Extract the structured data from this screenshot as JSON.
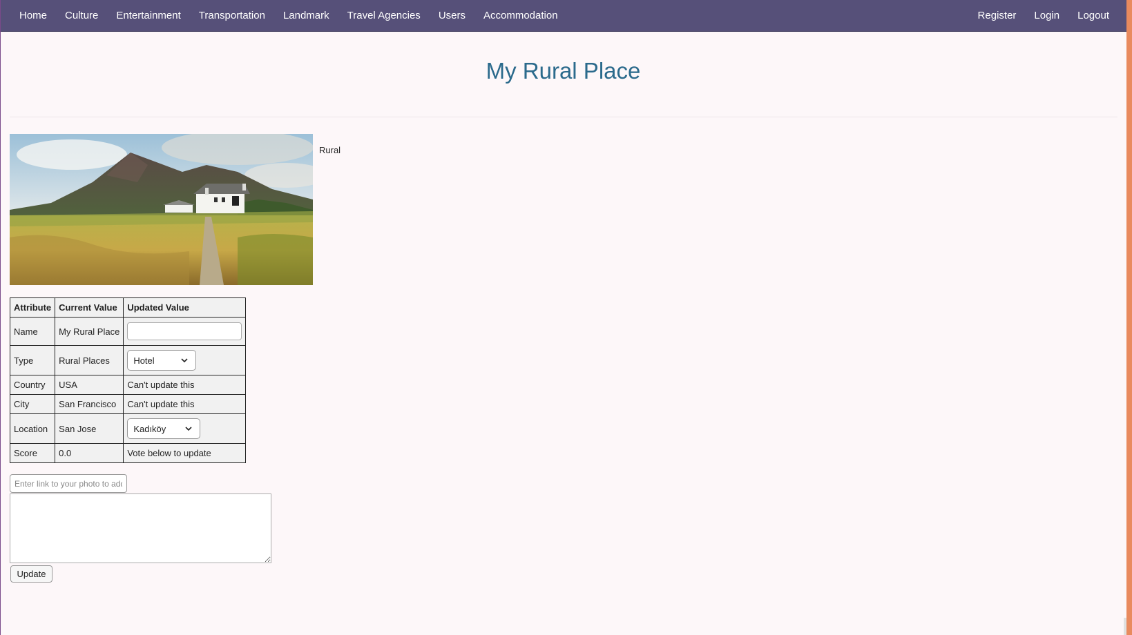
{
  "nav": {
    "left": [
      "Home",
      "Culture",
      "Entertainment",
      "Transportation",
      "Landmark",
      "Travel Agencies",
      "Users",
      "Accommodation"
    ],
    "right": [
      "Register",
      "Login",
      "Logout"
    ]
  },
  "page": {
    "title": "My Rural Place",
    "photo_caption": "Rural"
  },
  "table": {
    "headers": [
      "Attribute",
      "Current Value",
      "Updated Value"
    ],
    "name": {
      "attr": "Name",
      "current": "My Rural Place",
      "input_value": ""
    },
    "type": {
      "attr": "Type",
      "current": "Rural Places",
      "selected": "Hotel"
    },
    "country": {
      "attr": "Country",
      "current": "USA",
      "updated": "Can't update this"
    },
    "city": {
      "attr": "City",
      "current": "San Francisco",
      "updated": "Can't update this"
    },
    "location": {
      "attr": "Location",
      "current": "San Jose",
      "selected": "Kadıköy"
    },
    "score": {
      "attr": "Score",
      "current": "0.0",
      "updated": "Vote below to update"
    }
  },
  "form": {
    "photo_link_placeholder": "Enter link to your photo to add",
    "update_label": "Update"
  }
}
